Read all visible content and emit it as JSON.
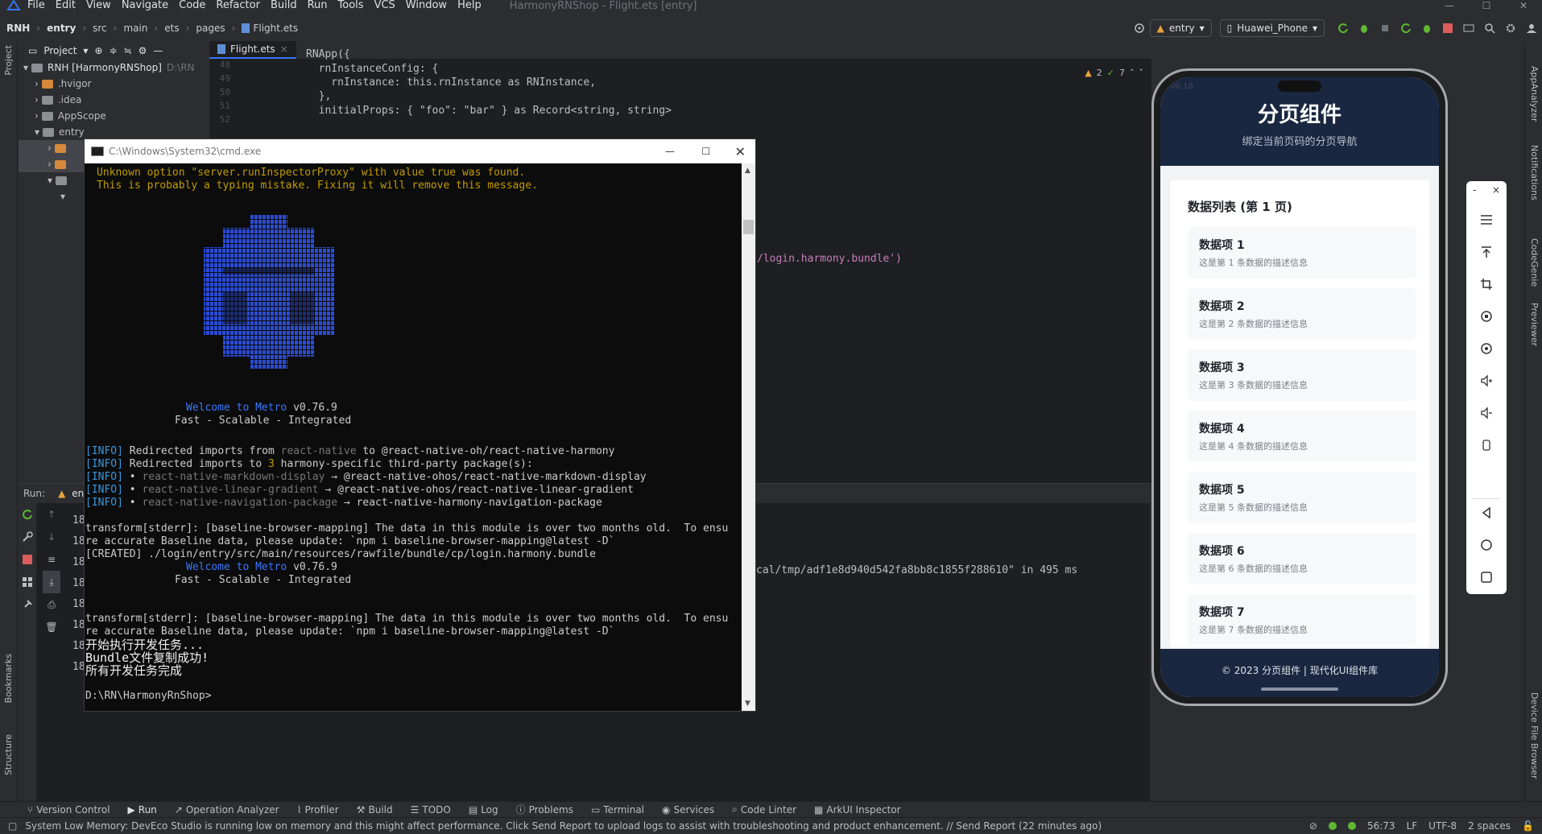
{
  "menubar": {
    "items": [
      "File",
      "Edit",
      "View",
      "Navigate",
      "Code",
      "Refactor",
      "Build",
      "Run",
      "Tools",
      "VCS",
      "Window",
      "Help"
    ],
    "window_title": "HarmonyRNShop - Flight.ets [entry]"
  },
  "breadcrumb": [
    "RNH",
    "entry",
    "src",
    "main",
    "ets",
    "pages",
    "Flight.ets"
  ],
  "toolbar": {
    "run_config": "entry",
    "device": "Huawei_Phone"
  },
  "project": {
    "header": "Project",
    "root": "RNH [HarmonyRNShop]",
    "root_path": "D:\\RN",
    "items": [
      ".hvigor",
      ".idea",
      "AppScope",
      "entry"
    ]
  },
  "editor": {
    "tab": "Flight.ets",
    "line_numbers": [
      "48",
      "49",
      "50",
      "51",
      "52"
    ],
    "code": [
      "RNApp({",
      "  rnInstanceConfig: {",
      "    rnInstance: this.rnInstance as RNInstance,",
      "  },",
      "  initialProps: { \"foo\": \"bar\" } as Record<string, string>"
    ],
    "bundle_fragment": "/login.harmony.bundle')",
    "inspections": {
      "warnings": "2",
      "ok": "7"
    }
  },
  "run": {
    "label": "Run:",
    "tab": "en",
    "line_prefix": "18",
    "output_fragment": "cal/tmp/adf1e8d940d542fa8bb8c1855f288610\" in 495 ms"
  },
  "cmd": {
    "title": "C:\\Windows\\System32\\cmd.exe",
    "warn1": "Unknown option \"server.runInspectorProxy\" with value true was found.",
    "warn2": "This is probably a typing mistake. Fixing it will remove this message.",
    "welcome": "Welcome to Metro",
    "version": "v0.76.9",
    "tagline": "Fast - Scalable - Integrated",
    "info_tag": "[INFO]",
    "info1": [
      "Redirected imports from ",
      "react-native",
      " to @react-native-oh/react-native-harmony"
    ],
    "info2": [
      "Redirected imports to ",
      "3",
      " harmony-specific third-party package(s):"
    ],
    "info3": [
      "react-native-markdown-display",
      "@react-native-ohos/react-native-markdown-display"
    ],
    "info4": [
      "react-native-linear-gradient",
      "@react-native-ohos/react-native-linear-gradient"
    ],
    "info5": [
      "react-native-navigation-package",
      "react-native-harmony-navigation-package"
    ],
    "stderr1": "transform[stderr]: [baseline-browser-mapping] The data in this module is over two months old.  To ensu",
    "stderr2": "re accurate Baseline data, please update: `npm i baseline-browser-mapping@latest -D`",
    "created": "[CREATED] ./login/entry/src/main/resources/rawfile/bundle/cp/login.harmony.bundle",
    "cn1": "开始执行开发任务...",
    "cn2": "Bundle文件复制成功!",
    "cn3": "所有开发任务完成",
    "prompt": "D:\\RN\\HarmonyRnShop>"
  },
  "phone": {
    "status_time": "06:18",
    "title": "分页组件",
    "subtitle": "绑定当前页码的分页导航",
    "list_title": "数据列表 (第 1 页)",
    "items": [
      {
        "t": "数据项 1",
        "d": "这是第 1 条数据的描述信息"
      },
      {
        "t": "数据项 2",
        "d": "这是第 2 条数据的描述信息"
      },
      {
        "t": "数据项 3",
        "d": "这是第 3 条数据的描述信息"
      },
      {
        "t": "数据项 4",
        "d": "这是第 4 条数据的描述信息"
      },
      {
        "t": "数据项 5",
        "d": "这是第 5 条数据的描述信息"
      },
      {
        "t": "数据项 6",
        "d": "这是第 6 条数据的描述信息"
      },
      {
        "t": "数据项 7",
        "d": "这是第 7 条数据的描述信息"
      }
    ],
    "footer": "© 2023 分页组件 | 现代化UI组件库"
  },
  "left_strip": {
    "project": "Project",
    "bookmarks": "Bookmarks",
    "structure": "Structure"
  },
  "right_strip": {
    "analyzer": "AppAnalyzer",
    "notifications": "Notifications",
    "codegenie": "CodeGenie",
    "previewer": "Previewer",
    "device_browser": "Device File Browser"
  },
  "bottom_tabs": [
    "Version Control",
    "Run",
    "Operation Analyzer",
    "Profiler",
    "Build",
    "TODO",
    "Log",
    "Problems",
    "Terminal",
    "Services",
    "Code Linter",
    "ArkUI Inspector"
  ],
  "status": {
    "message": "System Low Memory: DevEco Studio is running low on memory and this might affect performance. Click Send Report to upload logs to assist with troubleshooting and product enhancement. // Send Report (22 minutes ago)",
    "position": "56:73",
    "line_sep": "LF",
    "encoding": "UTF-8",
    "indent": "2 spaces"
  }
}
